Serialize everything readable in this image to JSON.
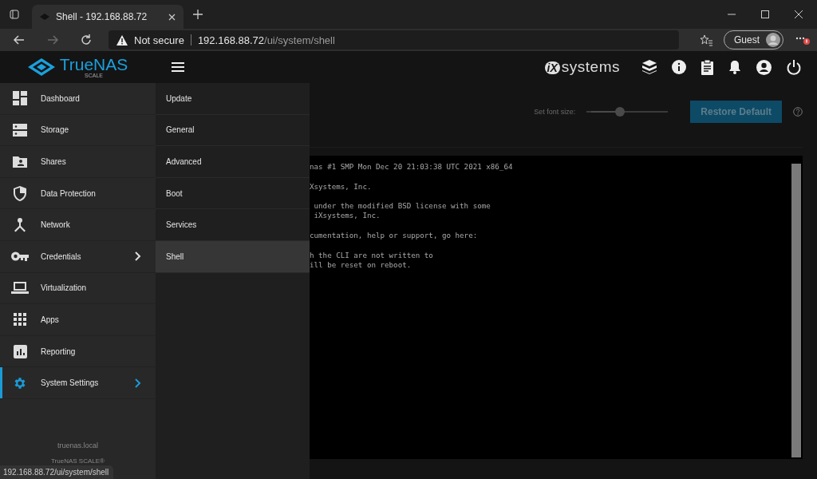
{
  "browser": {
    "tab": {
      "title": "Shell - 192.168.88.72",
      "selected": true
    },
    "nav": [
      {
        "kind": "back",
        "disabled": false
      },
      {
        "kind": "forward",
        "disabled": true
      },
      {
        "kind": "reload",
        "disabled": false
      }
    ],
    "security": "Not secure",
    "url": {
      "host": "192.168.88.72",
      "path": "/ui/system/shell"
    },
    "profile": "Guest",
    "status_url": "192.168.88.72/ui/system/shell"
  },
  "topbar": {
    "brand": "TrueNAS",
    "edition": "SCALE",
    "partner_mark": "iX",
    "partner": "systems"
  },
  "sidebar": {
    "items": [
      {
        "label": "Dashboard",
        "kind": "dashboard",
        "selected": false,
        "submenu": false
      },
      {
        "label": "Storage",
        "kind": "storage",
        "selected": false,
        "submenu": false
      },
      {
        "label": "Shares",
        "kind": "shares",
        "selected": false,
        "submenu": false
      },
      {
        "label": "Data Protection",
        "kind": "shield",
        "selected": false,
        "submenu": false
      },
      {
        "label": "Network",
        "kind": "network",
        "selected": false,
        "submenu": false
      },
      {
        "label": "Credentials",
        "kind": "key",
        "selected": false,
        "submenu": true
      },
      {
        "label": "Virtualization",
        "kind": "laptop",
        "selected": false,
        "submenu": false
      },
      {
        "label": "Apps",
        "kind": "apps",
        "selected": false,
        "submenu": false
      },
      {
        "label": "Reporting",
        "kind": "chart",
        "selected": false,
        "submenu": false
      },
      {
        "label": "System Settings",
        "kind": "gear",
        "selected": true,
        "submenu": true
      }
    ],
    "hostname": "truenas.local",
    "product": "TrueNAS SCALE®"
  },
  "submenu": {
    "items": [
      {
        "label": "Update",
        "selected": false
      },
      {
        "label": "General",
        "selected": false
      },
      {
        "label": "Advanced",
        "selected": false
      },
      {
        "label": "Boot",
        "selected": false
      },
      {
        "label": "Services",
        "selected": false
      },
      {
        "label": "Shell",
        "selected": true
      }
    ]
  },
  "shell": {
    "font_size_label": "Set font size:",
    "font_size": {
      "level": 0.4
    },
    "restore_button": "Restore Default",
    "output": [
      [
        "nas #1 SMP Mon Dec 20 21:03:38 UTC 2021 x86_64"
      ],
      [
        "Xsystems, Inc."
      ],
      [
        " under the modified BSD license with some",
        " iXsystems, Inc."
      ],
      [
        "cumentation, help or support, go here:"
      ],
      [
        "h the CLI are not written to",
        "ill be reset on reboot."
      ]
    ]
  }
}
